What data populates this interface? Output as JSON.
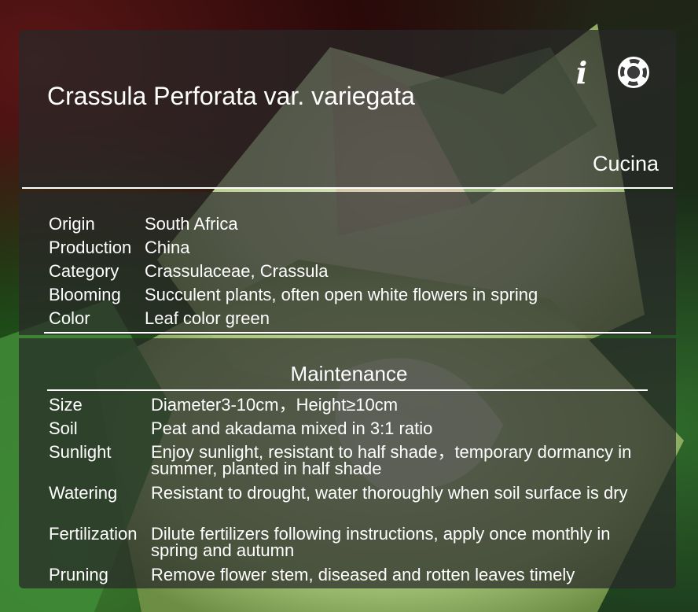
{
  "header": {
    "title": "Crassula Perforata var. variegata",
    "brand": "Cucina",
    "info_icon": "info-icon",
    "help_icon": "lifebuoy-icon"
  },
  "info": {
    "rows": [
      {
        "label": "Origin",
        "value": "South Africa"
      },
      {
        "label": "Production",
        "value": "China"
      },
      {
        "label": "Category",
        "value": "Crassulaceae, Crassula"
      },
      {
        "label": "Blooming",
        "value": "Succulent plants, often open white flowers in spring"
      },
      {
        "label": "Color",
        "value": "Leaf color green"
      }
    ]
  },
  "maintenance": {
    "title": "Maintenance",
    "rows": [
      {
        "label": "Size",
        "value": "Diameter3-10cm，Height≥10cm"
      },
      {
        "label": "Soil",
        "value": "Peat and akadama mixed in 3:1 ratio"
      },
      {
        "label": "Sunlight",
        "value": "Enjoy sunlight, resistant to half shade，temporary dormancy in summer, planted in half shade"
      },
      {
        "label": "Watering",
        "value": "Resistant to drought, water thoroughly when soil surface is dry"
      },
      {
        "label": "Fertilization",
        "value": "Dilute fertilizers following instructions, apply once monthly in spring and autumn"
      },
      {
        "label": "Pruning",
        "value": "Remove flower stem, diseased and rotten leaves timely"
      }
    ]
  },
  "colors": {
    "panel": "#282828",
    "text": "#ffffff"
  }
}
